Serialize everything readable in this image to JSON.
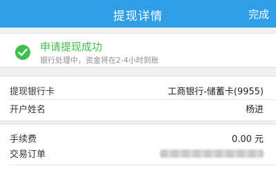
{
  "header": {
    "title": "提现详情",
    "done_label": "完成"
  },
  "status": {
    "title": "申请提现成功",
    "subtitle": "银行处理中，资金将在2-4小时到账",
    "icon": "check-circle-icon",
    "color": "#3fbf4a"
  },
  "account": {
    "bank_label": "提现银行卡",
    "bank_value": "工商银行-储蓄卡(9955)",
    "holder_label": "开户姓名",
    "holder_value": "杨进"
  },
  "fees": {
    "fee_label": "手续费",
    "fee_value": "0.00 元",
    "order_label": "交易订单"
  },
  "colors": {
    "navbar": "#2e9ee9",
    "success": "#3fbf4a"
  }
}
